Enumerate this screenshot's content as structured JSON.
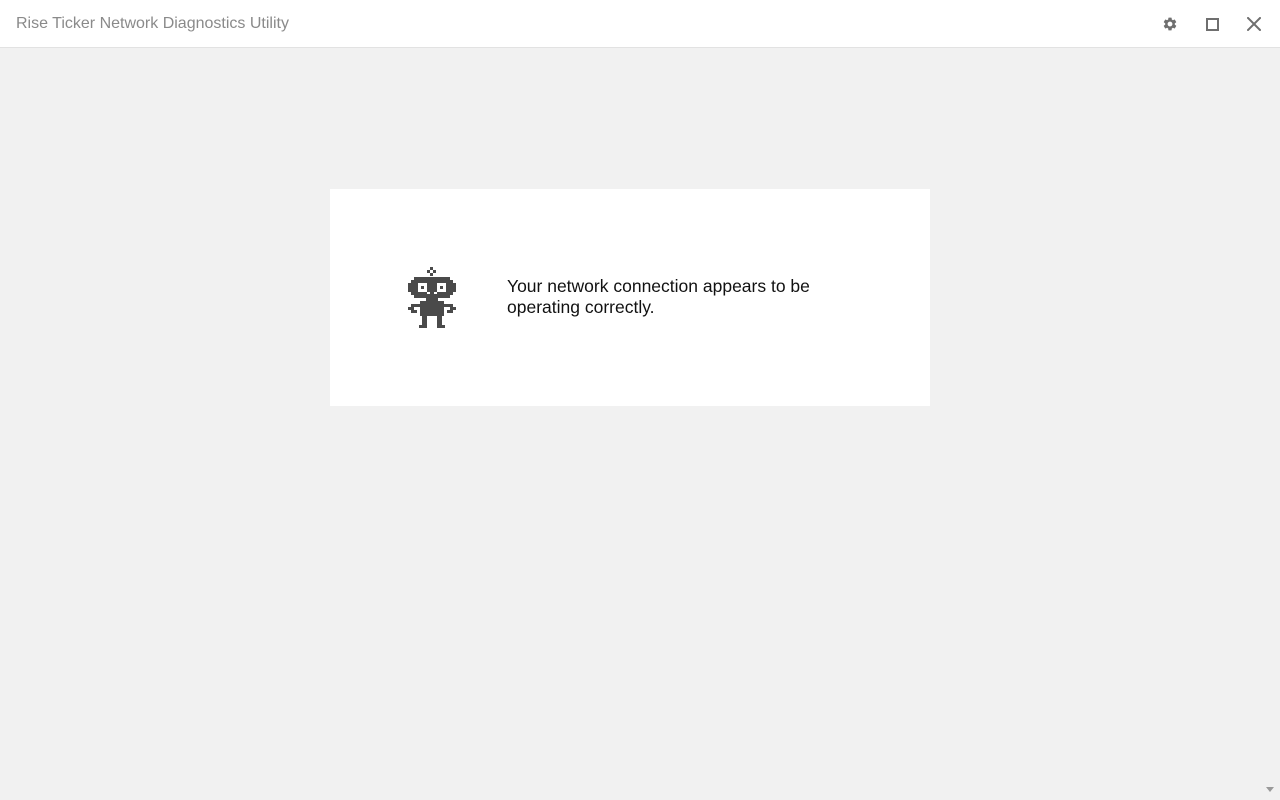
{
  "window": {
    "title": "Rise Ticker Network Diagnostics Utility",
    "icons": {
      "settings": "gear-icon",
      "maximize": "maximize-icon",
      "close": "close-icon"
    }
  },
  "status": {
    "illustration": "robot-icon",
    "message": "Your network connection appears to be operating correctly."
  },
  "colors": {
    "icon": "#6f6f6f",
    "robot": "#4a4a4a",
    "background": "#f1f1f1",
    "card": "#ffffff"
  }
}
